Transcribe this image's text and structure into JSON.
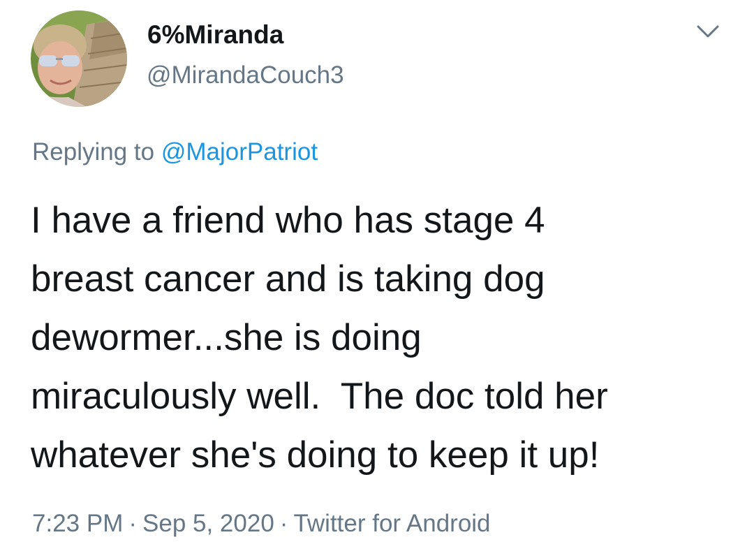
{
  "author": {
    "display_name": "6%Miranda",
    "handle": "@MirandaCouch3"
  },
  "reply": {
    "prefix": "Replying to",
    "mention": "@MajorPatriot"
  },
  "tweet": {
    "lines": [
      "I have a friend who has stage 4",
      "breast cancer and is taking dog",
      "dewormer...she is doing",
      "miraculously well.  The doc told her",
      "whatever she's doing to keep it up!"
    ]
  },
  "meta": {
    "time": "7:23 PM",
    "separator": "·",
    "date": "Sep 5, 2020",
    "source": "Twitter for Android"
  },
  "icons": {
    "menu": "chevron-down-icon",
    "avatar": "profile-photo"
  },
  "colors": {
    "text": "#14171a",
    "muted": "#657786",
    "link": "#1b95e0",
    "background": "#ffffff"
  }
}
